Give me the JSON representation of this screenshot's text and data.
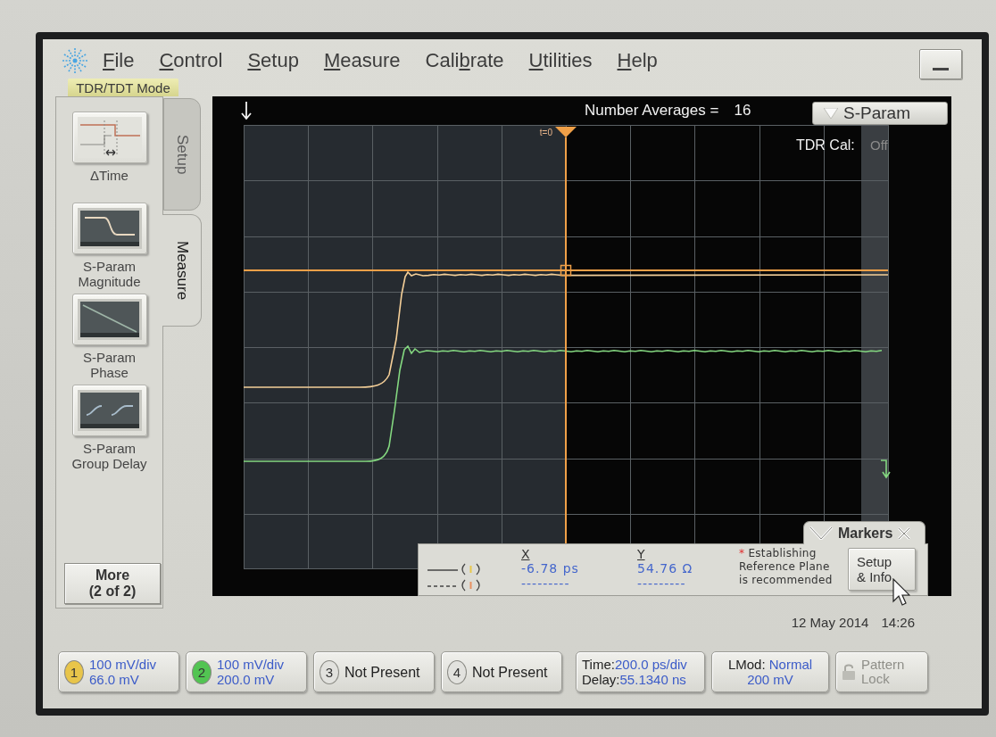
{
  "menu": {
    "items": [
      {
        "parts": [
          {
            "text": "F",
            "underlined": true
          },
          {
            "text": "ile",
            "underlined": false
          }
        ]
      },
      {
        "parts": [
          {
            "text": "C",
            "underlined": true
          },
          {
            "text": "ontrol",
            "underlined": false
          }
        ]
      },
      {
        "parts": [
          {
            "text": "S",
            "underlined": true
          },
          {
            "text": "etup",
            "underlined": false
          }
        ]
      },
      {
        "parts": [
          {
            "text": "M",
            "underlined": true
          },
          {
            "text": "easure",
            "underlined": false
          }
        ]
      },
      {
        "parts": [
          {
            "text": "Cali",
            "underlined": false
          },
          {
            "text": "b",
            "underlined": true
          },
          {
            "text": "rate",
            "underlined": false
          }
        ]
      },
      {
        "parts": [
          {
            "text": "U",
            "underlined": true
          },
          {
            "text": "tilities",
            "underlined": false
          }
        ]
      },
      {
        "parts": [
          {
            "text": "H",
            "underlined": true
          },
          {
            "text": "elp",
            "underlined": false
          }
        ]
      }
    ]
  },
  "mode_label": "TDR/TDT Mode",
  "side_panel": {
    "tools": [
      {
        "kind": "delta_time",
        "label": "ΔTime"
      },
      {
        "kind": "magnitude",
        "label": "S-Param\nMagnitude"
      },
      {
        "kind": "phase",
        "label": "S-Param\nPhase"
      },
      {
        "kind": "group_delay",
        "label": "S-Param\nGroup Delay"
      }
    ],
    "tabs": [
      {
        "label": "Setup",
        "selected": false
      },
      {
        "label": "Measure",
        "selected": true
      }
    ],
    "more_button": "More\n(2 of 2)"
  },
  "display": {
    "averages_label": "Number Averages =",
    "averages_value": "16",
    "sparam_button": "S-Param",
    "t0_label": "t=0",
    "tdr_cal_label": "TDR Cal:",
    "tdr_cal_value": "Off"
  },
  "markers": {
    "title": "Markers",
    "x_header": "X",
    "y_header": "Y",
    "rows": [
      {
        "kind": "solid",
        "x": "-6.78 ps",
        "y": "54.76 Ω"
      },
      {
        "kind": "dashed",
        "x": "---------",
        "y": "---------"
      }
    ],
    "note_mark": "*",
    "note": "Establishing\nReference Plane\nis recommended",
    "button": "Setup\n& Info"
  },
  "timestamp": {
    "date": "12 May 2014",
    "time": "14:26"
  },
  "bottom_bar": {
    "channels": [
      {
        "number": "1",
        "present": true,
        "color": "#e8c54a",
        "scale": "100 mV/div",
        "offset": "66.0 mV"
      },
      {
        "number": "2",
        "present": true,
        "color": "#52c452",
        "scale": "100 mV/div",
        "offset": "200.0 mV"
      },
      {
        "number": "3",
        "present": false,
        "color": "#e2e2de",
        "status": "Not Present"
      },
      {
        "number": "4",
        "present": false,
        "color": "#e2e2de",
        "status": "Not Present"
      }
    ],
    "timebase": {
      "time_label": "Time:",
      "time_value": "200.0 ps/div",
      "delay_label": "Delay:",
      "delay_value": "55.1340 ns"
    },
    "lmod": {
      "label": "LMod:",
      "mode": "Normal",
      "amplitude": "200 mV"
    },
    "pattern_lock": {
      "label": "Pattern\nLock",
      "disabled": true
    }
  }
}
